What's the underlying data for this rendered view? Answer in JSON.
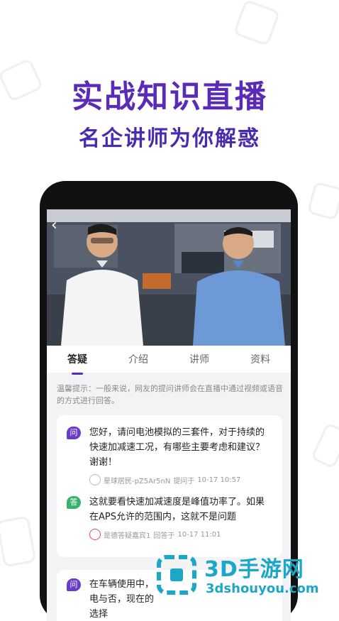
{
  "banner": {
    "title": "实战知识直播",
    "subtitle": "名企讲师为你解惑"
  },
  "tabs": [
    "答疑",
    "介绍",
    "讲师",
    "资料"
  ],
  "notice": "温馨提示：一般来说，网友的提问讲师会在直播中通过视频或语音的方式进行回答。",
  "qa": [
    {
      "badge": "问",
      "text": "您好，请问电池模拟的三套件，对于持续的快速加减速工况，有哪些主要考虑和建议？谢谢！",
      "author": "星球居民-pZ5Ar5nN",
      "action": "提问于",
      "time": "10-17 10:57"
    },
    {
      "badge": "答",
      "text": "这就要看快速加减速度是峰值功率了。如果在APS允许的范围内，这就不是问题",
      "author": "是德答疑嘉宾1",
      "action": "回答于",
      "time": "10-17 11:01"
    },
    {
      "badge": "问",
      "text": "在车辆使用中，电与否，现在的选择"
    }
  ],
  "watermark": {
    "title": "3D手游网",
    "url": "3dshouyou.com"
  },
  "colors": {
    "accent": "#5a2bb8",
    "question_badge": "#6a3cc8",
    "answer_badge": "#36b36a",
    "watermark": "#1aa7c8"
  }
}
